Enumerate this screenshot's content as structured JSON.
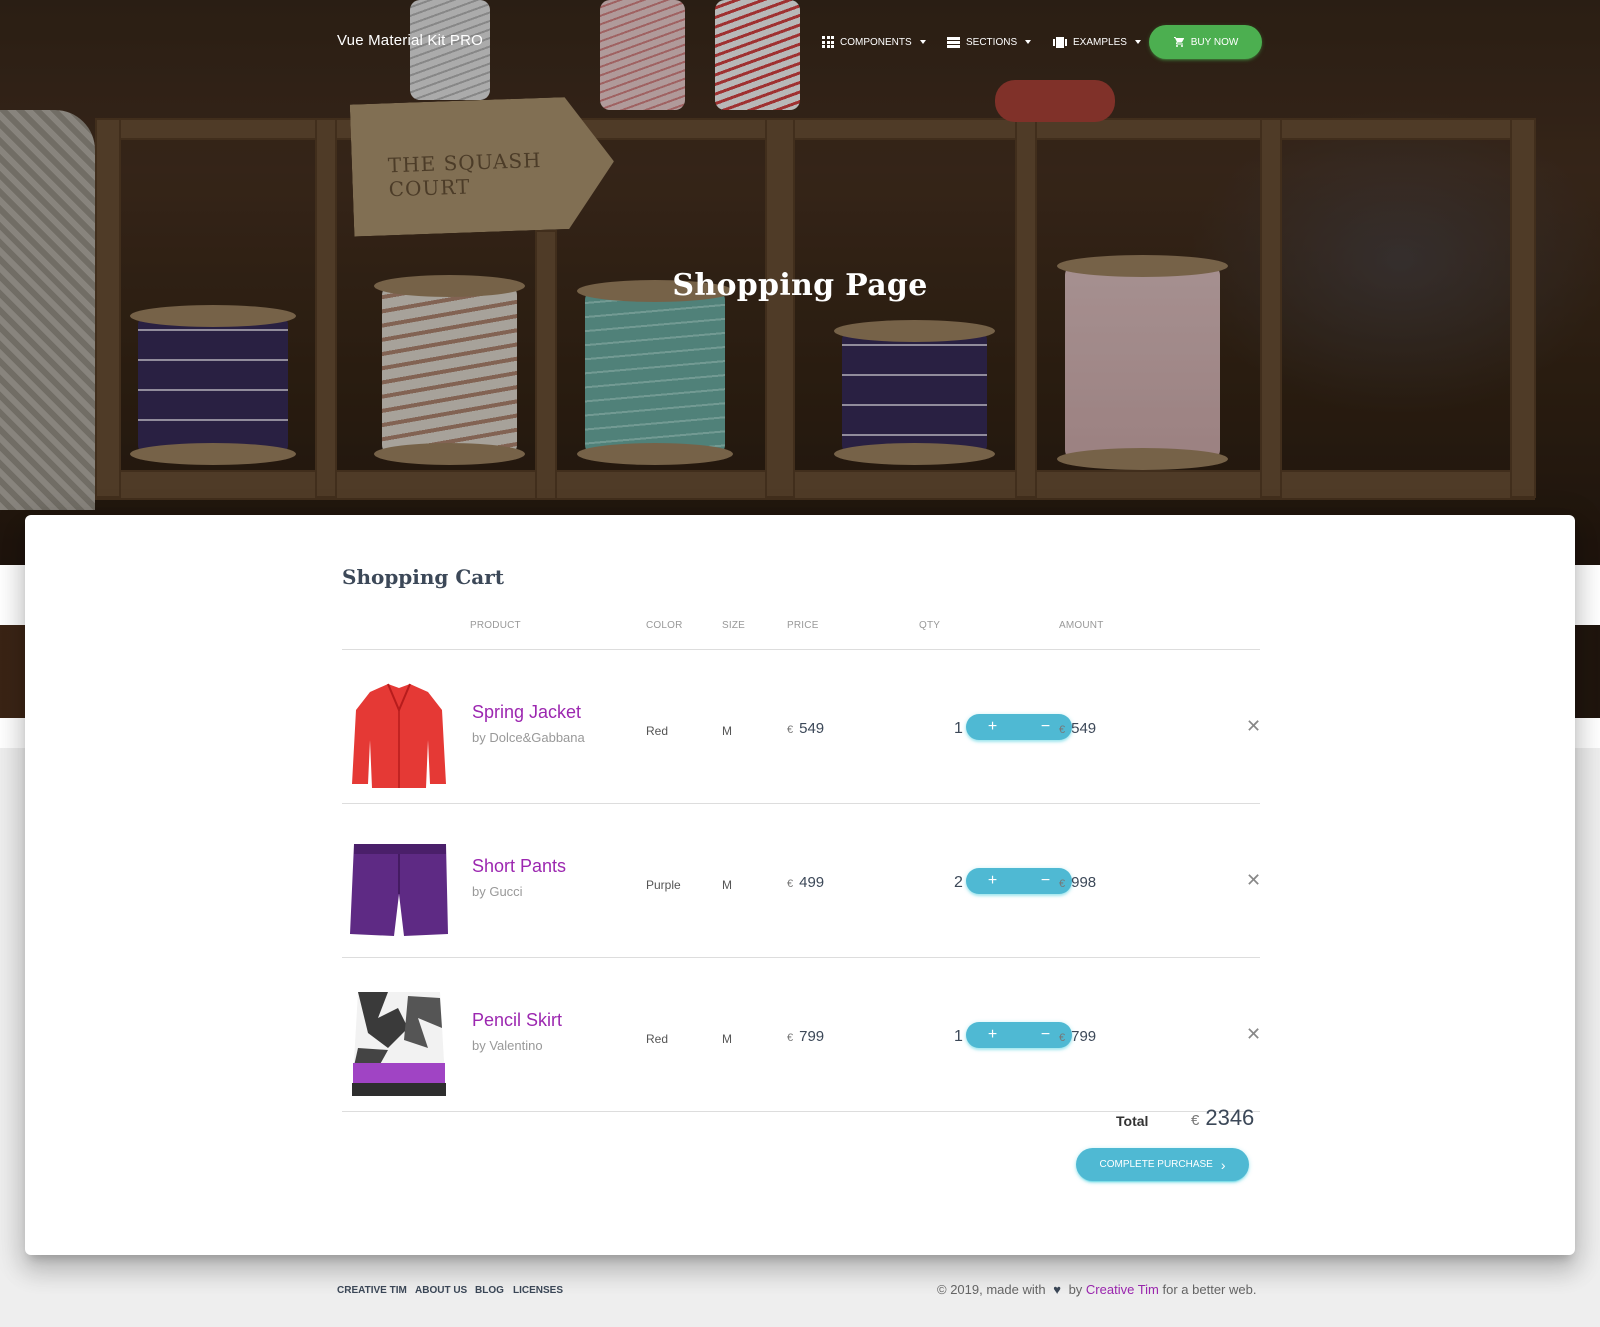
{
  "navbar": {
    "brand": "Vue Material Kit PRO",
    "items": [
      {
        "label": "Components",
        "icon": "apps-icon"
      },
      {
        "label": "Sections",
        "icon": "view-day-icon"
      },
      {
        "label": "Examples",
        "icon": "view-carousel-icon"
      }
    ],
    "buy_now": "Buy Now"
  },
  "hero": {
    "title": "Shopping Page",
    "tag_text": "THE SQUASH COURT"
  },
  "cart": {
    "title": "Shopping Cart",
    "headers": {
      "product": "Product",
      "color": "Color",
      "size": "Size",
      "price": "Price",
      "qty": "Qty",
      "amount": "Amount"
    },
    "currency": "€",
    "items": [
      {
        "name": "Spring Jacket",
        "brand": "by Dolce&Gabbana",
        "color": "Red",
        "size": "M",
        "price": "549",
        "qty": "1",
        "amount": "549",
        "thumb_color": "#e53935"
      },
      {
        "name": "Short Pants",
        "brand": "by Gucci",
        "color": "Purple",
        "size": "M",
        "price": "499",
        "qty": "2",
        "amount": "998",
        "thumb_color": "#5e2a84"
      },
      {
        "name": "Pencil Skirt",
        "brand": "by Valentino",
        "color": "Red",
        "size": "M",
        "price": "799",
        "qty": "1",
        "amount": "799",
        "thumb_color": "#3a3a3a"
      }
    ],
    "plus": "+",
    "minus": "−",
    "remove": "✕",
    "total_label": "Total",
    "total_value": "2346",
    "purchase_button": "Complete Purchase",
    "purchase_chevron": "›"
  },
  "footer": {
    "links": [
      "Creative Tim",
      "About Us",
      "Blog",
      "Licenses"
    ],
    "copyright_prefix": "© 2019, made with",
    "heart": "♥",
    "copyright_by": "by",
    "author": "Creative Tim",
    "copyright_suffix": "for a better web."
  },
  "colors": {
    "accent_purple": "#9c27b0",
    "info_blue": "#4fb9d3",
    "success_green": "#4caf50"
  }
}
